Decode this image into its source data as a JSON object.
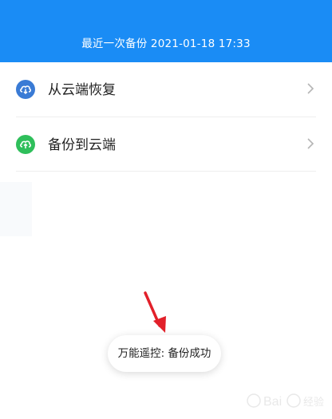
{
  "header": {
    "last_backup": "最近一次备份 2021-01-18 17:33"
  },
  "menu": {
    "items": [
      {
        "label": "从云端恢复",
        "icon": "cloud-download-icon",
        "icon_color": "#3a7bd5"
      },
      {
        "label": "备份到云端",
        "icon": "cloud-upload-icon",
        "icon_color": "#2fbf5b"
      }
    ]
  },
  "toast": {
    "text": "万能遥控: 备份成功"
  },
  "colors": {
    "header_bg": "#1a8cf5",
    "annotation_arrow": "#e2202a"
  },
  "watermark": {
    "text": "Baidu 经验"
  }
}
